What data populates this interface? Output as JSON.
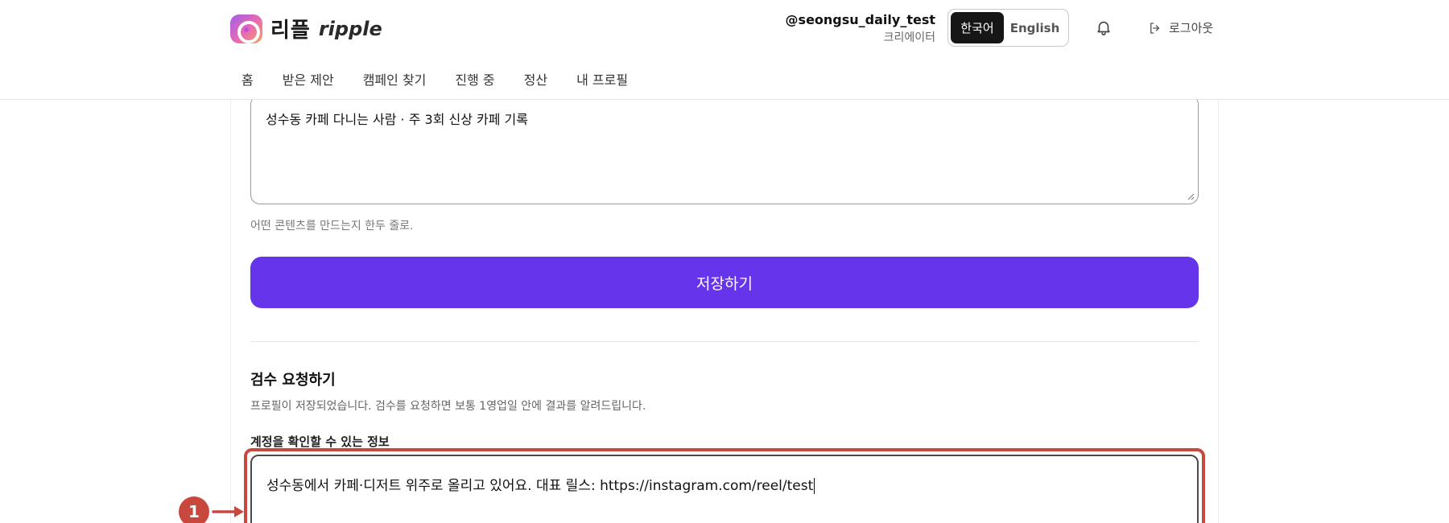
{
  "header": {
    "logo_ko": "리플",
    "logo_en": "ripple",
    "user_handle": "@seongsu_daily_test",
    "user_role": "크리에이터",
    "lang_ko": "한국어",
    "lang_en": "English",
    "logout_label": "로그아웃"
  },
  "nav": {
    "items": [
      {
        "label": "홈"
      },
      {
        "label": "받은 제안"
      },
      {
        "label": "캠페인 찾기"
      },
      {
        "label": "진행 중"
      },
      {
        "label": "정산"
      },
      {
        "label": "내 프로필"
      }
    ]
  },
  "profile_form": {
    "bio_value": "성수동 카페 다니는 사람 · 주 3회 신상 카페 기록",
    "bio_hint": "어떤 콘텐츠를 만드는지 한두 줄로.",
    "save_label": "저장하기"
  },
  "review_section": {
    "title": "검수 요청하기",
    "description": "프로필이 저장되었습니다. 검수를 요청하면 보통 1영업일 안에 결과를 알려드립니다.",
    "field_label": "계정을 확인할 수 있는 정보",
    "field_value": "성수동에서 카페·디저트 위주로 올리고 있어요. 대표 릴스: https://instagram.com/reel/test"
  },
  "annotation": {
    "marker_number": "1",
    "color": "#c8483e"
  },
  "colors": {
    "accent": "#6634ea",
    "annotation": "#c8483e"
  }
}
